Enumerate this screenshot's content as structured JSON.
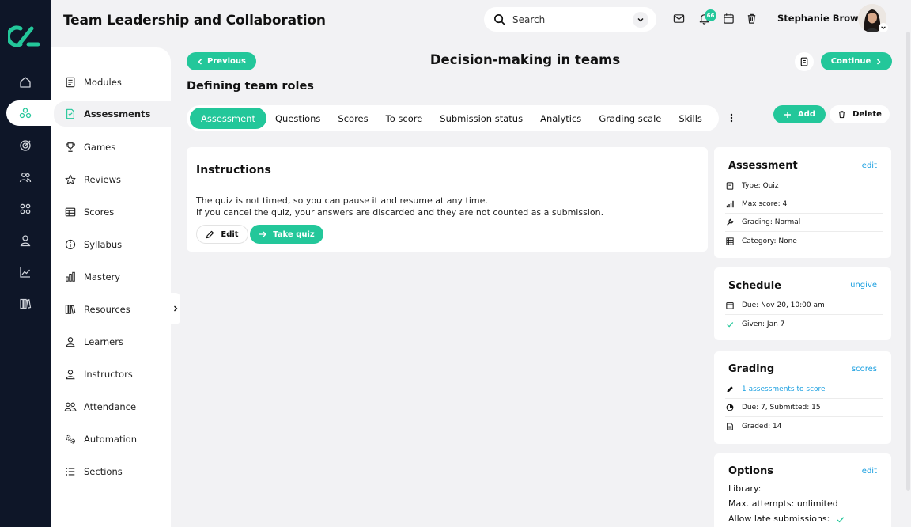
{
  "app": {
    "title": "Team Leadership and Collaboration"
  },
  "header": {
    "search_placeholder": "Search",
    "notification_count": "66",
    "user_name": "Stephanie Brown"
  },
  "rail": {
    "icons": [
      "home-icon",
      "hub-icon",
      "target-icon",
      "people-icon",
      "apps-icon",
      "person-icon",
      "chart-icon",
      "library-icon"
    ],
    "active_index": 1
  },
  "sidebar": {
    "items": [
      {
        "label": "Modules",
        "icon": "book-icon"
      },
      {
        "label": "Assessments",
        "icon": "document-icon",
        "active": true
      },
      {
        "label": "Games",
        "icon": "trophy-icon"
      },
      {
        "label": "Reviews",
        "icon": "star-icon"
      },
      {
        "label": "Scores",
        "icon": "table-icon"
      },
      {
        "label": "Syllabus",
        "icon": "info-icon"
      },
      {
        "label": "Mastery",
        "icon": "bar-chart-icon"
      },
      {
        "label": "Resources",
        "icon": "books-icon"
      },
      {
        "label": "Learners",
        "icon": "user-icon"
      },
      {
        "label": "Instructors",
        "icon": "user-icon"
      },
      {
        "label": "Attendance",
        "icon": "users-icon"
      },
      {
        "label": "Automation",
        "icon": "gears-icon"
      },
      {
        "label": "Sections",
        "icon": "list-icon"
      }
    ]
  },
  "page": {
    "prev_label": "Previous",
    "title": "Decision-making in teams",
    "continue_label": "Continue",
    "section_title": "Defining team roles"
  },
  "tabs": [
    "Assessment",
    "Questions",
    "Scores",
    "To score",
    "Submission status",
    "Analytics",
    "Grading scale",
    "Skills"
  ],
  "actions": {
    "add_label": "Add",
    "delete_label": "Delete"
  },
  "instructions": {
    "title": "Instructions",
    "line1": "The quiz is not timed, so you can pause it and resume at any time.",
    "line2": "If you cancel the quiz, your answers are discarded and they are not counted as a submission.",
    "edit_label": "Edit",
    "take_label": "Take quiz"
  },
  "assessment_panel": {
    "title": "Assessment",
    "link": "edit",
    "rows": [
      "Type: Quiz",
      "Max score: 4",
      "Grading: Normal",
      "Category: None"
    ]
  },
  "schedule_panel": {
    "title": "Schedule",
    "link": "ungive",
    "rows": [
      "Due: Nov 20, 10:00 am",
      "Given: Jan 7"
    ]
  },
  "grading_panel": {
    "title": "Grading",
    "link": "scores",
    "rows": [
      "1 assessments to score",
      "Due: 7, Submitted: 15",
      "Graded: 14"
    ]
  },
  "options_panel": {
    "title": "Options",
    "link": "edit",
    "lines": [
      "Library:",
      "Max. attempts: unlimited",
      "Allow late submissions:"
    ]
  },
  "colors": {
    "accent": "#23c79a",
    "rail": "#0e1628",
    "link": "#1a9fe0"
  }
}
